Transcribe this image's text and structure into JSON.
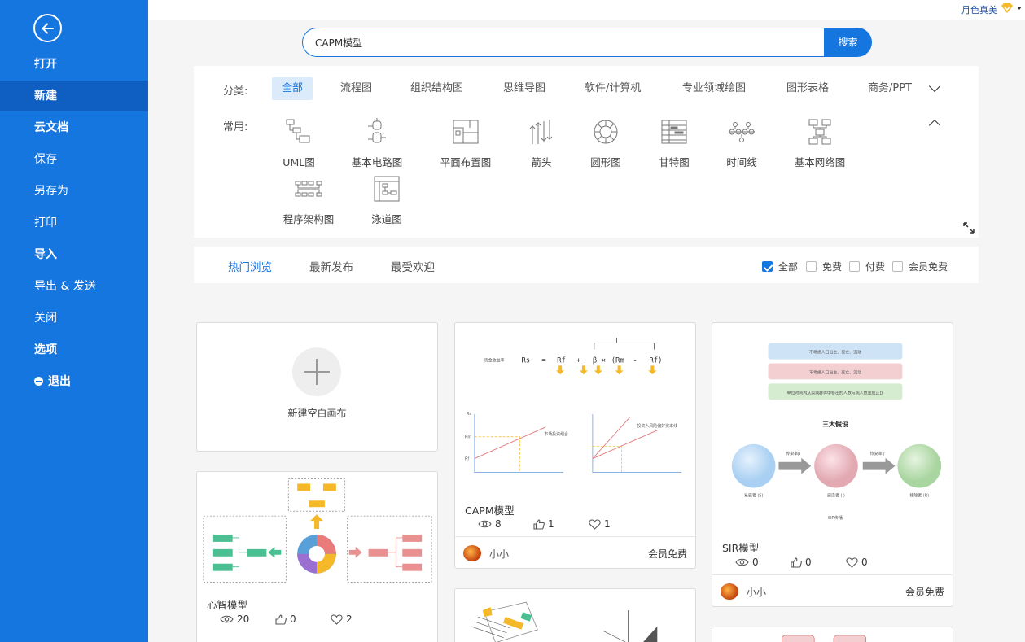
{
  "sidebar": {
    "items": [
      {
        "label": "打开"
      },
      {
        "label": "新建"
      },
      {
        "label": "云文档"
      },
      {
        "label": "保存"
      },
      {
        "label": "另存为"
      },
      {
        "label": "打印"
      },
      {
        "label": "导入"
      },
      {
        "label": "导出 & 发送"
      },
      {
        "label": "关闭"
      },
      {
        "label": "选项"
      },
      {
        "label": "退出"
      }
    ]
  },
  "header": {
    "user_name": "月色真美"
  },
  "search": {
    "value": "CAPM模型",
    "button_label": "搜索"
  },
  "categories": {
    "label": "分类:",
    "tabs": [
      "全部",
      "流程图",
      "组织结构图",
      "思维导图",
      "软件/计算机",
      "专业领域绘图",
      "图形表格",
      "商务/PPT"
    ],
    "common_label": "常用:",
    "common_items": [
      "UML图",
      "基本电路图",
      "平面布置图",
      "箭头",
      "圆形图",
      "甘特图",
      "时间线",
      "基本网络图",
      "程序架构图",
      "泳道图"
    ]
  },
  "sort": {
    "tabs": [
      "热门浏览",
      "最新发布",
      "最受欢迎"
    ],
    "filters": [
      {
        "label": "全部",
        "checked": true
      },
      {
        "label": "免费",
        "checked": false
      },
      {
        "label": "付费",
        "checked": false
      },
      {
        "label": "会员免费",
        "checked": false
      }
    ]
  },
  "new_canvas_label": "新建空白画布",
  "cards": [
    {
      "title": "CAPM模型",
      "views": "8",
      "likes": "1",
      "favorites": "1",
      "author": "小小",
      "price": "会员免费"
    },
    {
      "title": "SIR模型",
      "views": "0",
      "likes": "0",
      "favorites": "0",
      "author": "小小",
      "price": "会员免费"
    },
    {
      "title": "心智模型",
      "views": "20",
      "likes": "0",
      "favorites": "2"
    }
  ],
  "capm_thumb": {
    "formula_label": "资金收益率",
    "formula": [
      "Rs",
      "=",
      "Rf",
      "+",
      "β",
      "×",
      "(Rm",
      "-",
      "Rf)"
    ],
    "axis_labels": [
      "Rm",
      "Rf",
      "Rs"
    ],
    "note_left": "市场投资组合",
    "note_right": "投资人风险偏好资本线"
  },
  "sir_thumb": {
    "assumptions": [
      "不考虑人口出生、死亡、流动",
      "不考虑人口出生、死亡、流动",
      "单位时间内从染病群体中移出的人数与病人数量成正比"
    ],
    "heading": "三大假设",
    "nodes": [
      "易感者 (S)",
      "感染者 (I)",
      "移除者 (R)"
    ],
    "arrows": [
      "传染率β",
      "恢复率γ"
    ],
    "caption": "SIR传播"
  },
  "colors": {
    "accent": "#1676e0",
    "sidebar": "#1676e0",
    "sidebar_active": "#0f5fc2"
  }
}
